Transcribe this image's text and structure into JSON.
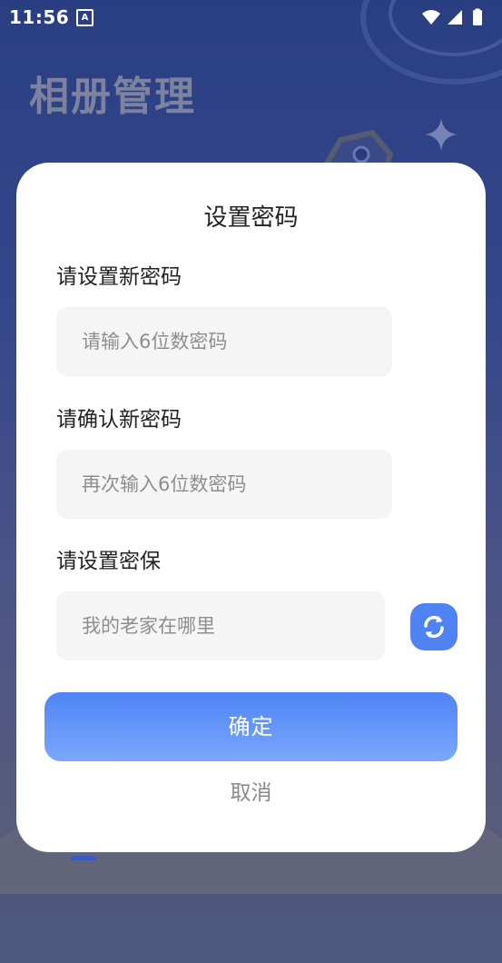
{
  "status_bar": {
    "time": "11:56",
    "notification_glyph": "A"
  },
  "background": {
    "app_title": "相册管理"
  },
  "dialog": {
    "title": "设置密码",
    "new_password": {
      "label": "请设置新密码",
      "placeholder": "请输入6位数密码"
    },
    "confirm_password": {
      "label": "请确认新密码",
      "placeholder": "再次输入6位数密码"
    },
    "security": {
      "label": "请设置密保",
      "question": "我的老家在哪里",
      "refresh_icon": "refresh-icon"
    },
    "confirm_label": "确定",
    "cancel_label": "取消"
  },
  "colors": {
    "accent": "#4f83f4",
    "button_gradient_end": "#7aa8fb"
  }
}
